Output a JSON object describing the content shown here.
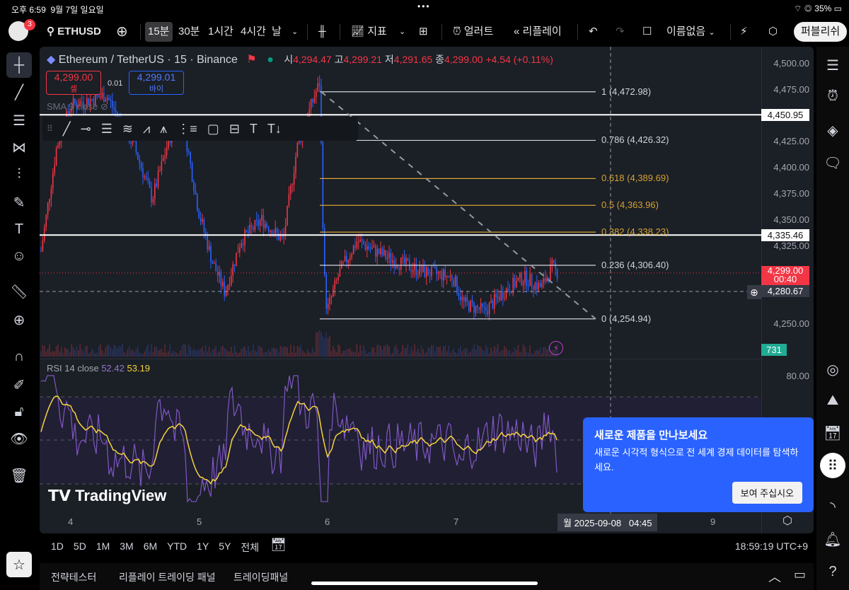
{
  "status": {
    "time": "오후 6:59",
    "date": "9월 7일 일요일",
    "battery": "35%"
  },
  "toolbar": {
    "symbol": "ETHUSD",
    "notif_count": "3",
    "intervals": [
      "15분",
      "30분",
      "1시간",
      "4시간",
      "날"
    ],
    "indicators": "지표",
    "alert": "얼러트",
    "replay": "리플레이",
    "layout_name": "이름없음",
    "publish": "퍼블리쉬"
  },
  "legend": {
    "title": "Ethereum / TetherUS · 15 · Binance",
    "o_label": "시",
    "o": "4,294.47",
    "h_label": "고",
    "h": "4,299.21",
    "l_label": "저",
    "l": "4,291.65",
    "c_label": "종",
    "c": "4,299.00",
    "change": "+4.54 (+0.11%)",
    "sell_price": "4,299.00",
    "sell_label": "셀",
    "spread": "0.01",
    "buy_price": "4,299.01",
    "buy_label": "바이",
    "sma": "SMA 9 close"
  },
  "price_axis": [
    "4,500.00",
    "4,475.00",
    "4,425.00",
    "4,400.00",
    "4,375.00",
    "4,350.00",
    "4,325.00",
    "4,250.00"
  ],
  "price_tags": {
    "line1": "4,450.95",
    "line2": "4,335.46",
    "last": "4,299.00",
    "countdown": "00:40",
    "crosshair": "4,280.67",
    "volume": "731"
  },
  "fib": [
    {
      "label": "1 (4,472.98)",
      "price": 4472.98,
      "color": "#d1d4dc"
    },
    {
      "label": "0.786 (4,426.32)",
      "price": 4426.32,
      "color": "#d1d4dc"
    },
    {
      "label": "0.618 (4,389.69)",
      "price": 4389.69,
      "color": "#d4a233"
    },
    {
      "label": "0.5 (4,363.96)",
      "price": 4363.96,
      "color": "#d4a233"
    },
    {
      "label": "0.382 (4,338.23)",
      "price": 4338.23,
      "color": "#d4a233"
    },
    {
      "label": "0.236 (4,306.40)",
      "price": 4306.4,
      "color": "#d1d4dc"
    },
    {
      "label": "0 (4,254.94)",
      "price": 4254.94,
      "color": "#d1d4dc"
    }
  ],
  "rsi": {
    "label": "RSI 14 close",
    "value1": "52.42",
    "value2": "53.19",
    "axis": "80.00"
  },
  "time_axis": [
    "4",
    "5",
    "6",
    "7",
    "9"
  ],
  "crosshair_time": "월 2025-09-08   04:45",
  "watermark": "TradingView",
  "ranges": [
    "1D",
    "5D",
    "1M",
    "3M",
    "6M",
    "YTD",
    "1Y",
    "5Y",
    "전체"
  ],
  "clock": "18:59:19 UTC+9",
  "panel_tabs": [
    "전략테스터",
    "리플레이 트레이딩 패널",
    "트레이딩패널"
  ],
  "popup": {
    "title": "새로운 제품을 만나보세요",
    "body": "새로운 시각적 형식으로 전 세계 경제 데이터를 탐색하세요.",
    "button": "보여 주십시오"
  },
  "colors": {
    "up": "#f23645",
    "down": "#2962ff",
    "accent": "#2962ff",
    "rsi": "#7e57c2",
    "rsi_ma": "#f5d33b"
  }
}
